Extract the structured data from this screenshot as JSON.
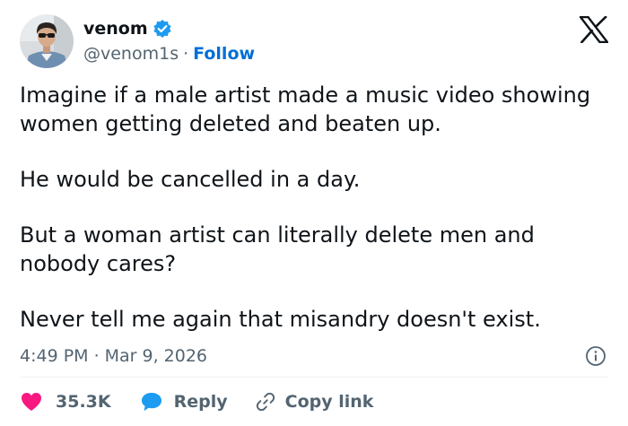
{
  "author": {
    "display_name": "venom",
    "handle": "@venom1s",
    "separator": "·",
    "follow_label": "Follow",
    "verified": true,
    "verified_color": "#1d9bf0"
  },
  "tweet": {
    "paragraphs": [
      "Imagine if a male artist made a music video showing women getting deleted and beaten up.",
      "He would be cancelled in a day.",
      "But a woman artist can literally delete men and nobody cares?",
      "Never tell me again that misandry doesn't exist."
    ],
    "time": "4:49 PM",
    "date_separator": "·",
    "date": "Mar 9, 2026"
  },
  "actions": {
    "like_count": "35.3K",
    "like_color": "#f91880",
    "reply_label": "Reply",
    "reply_color": "#1d9bf0",
    "copy_link_label": "Copy link"
  },
  "icons": {
    "brand": "x-logo-icon",
    "info": "info-icon",
    "like": "heart-icon",
    "reply": "speech-bubble-icon",
    "copy": "link-icon"
  }
}
